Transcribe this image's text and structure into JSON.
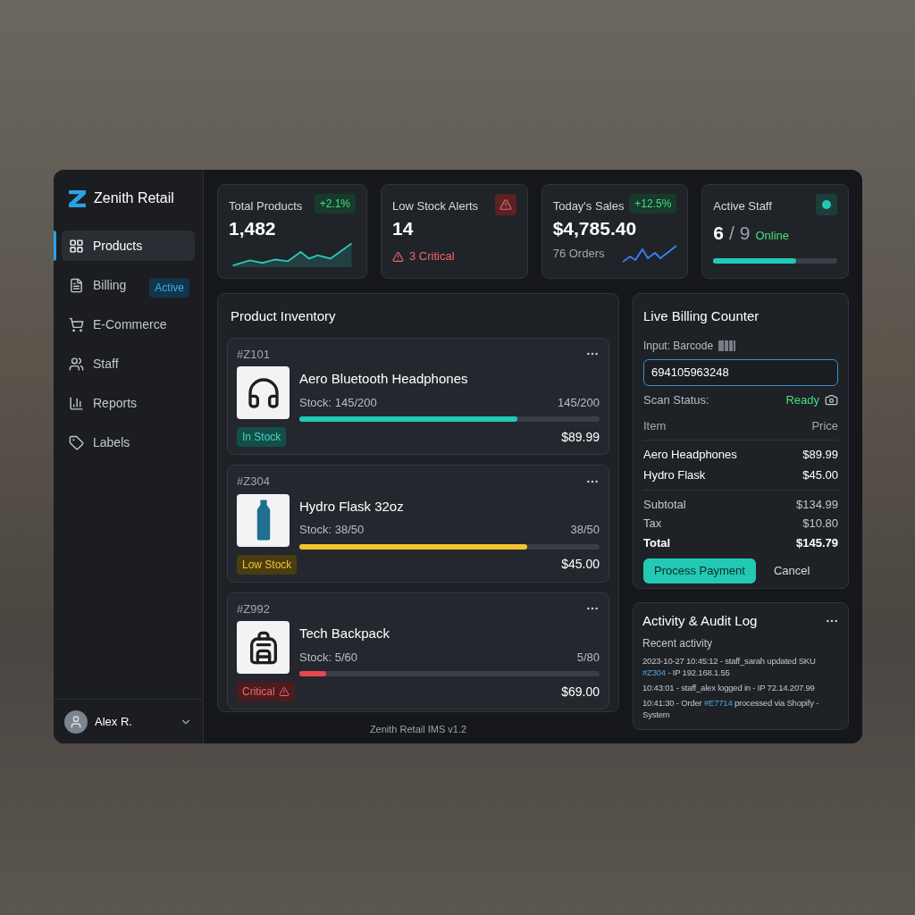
{
  "brand": {
    "name": "Zenith Retail"
  },
  "sidebar": {
    "items": [
      {
        "label": "Products",
        "selected": true
      },
      {
        "label": "Billing",
        "selected": false,
        "badge": "Active"
      },
      {
        "label": "E-Commerce",
        "selected": false
      },
      {
        "label": "Staff",
        "selected": false
      },
      {
        "label": "Reports",
        "selected": false
      },
      {
        "label": "Labels",
        "selected": false
      }
    ],
    "user": {
      "name": "Alex R."
    }
  },
  "stats": [
    {
      "kind": "trend",
      "title": "Total Products",
      "badge": "+2.1%",
      "value": "1,482"
    },
    {
      "kind": "alert",
      "title": "Low Stock Alerts",
      "value": "14",
      "note": "3 Critical"
    },
    {
      "kind": "sales",
      "title": "Today's Sales",
      "badge": "+12.5%",
      "value": "$4,785.40",
      "note": "76 Orders"
    },
    {
      "kind": "staff",
      "title": "Active Staff",
      "value": "6",
      "separator": "/",
      "total": "9",
      "note": "Online",
      "level": 0.667
    }
  ],
  "inventory": {
    "title": "Product Inventory",
    "products": [
      {
        "sku": "#Z101",
        "name": "Aero Bluetooth Headphones",
        "stock": "Stock: 145/200",
        "count": "145/200",
        "level": 0.725,
        "status": "In Stock",
        "kind": "ok",
        "price": "$89.99"
      },
      {
        "sku": "#Z304",
        "name": "Hydro Flask 32oz",
        "stock": "Stock: 38/50",
        "count": "38/50",
        "level": 0.76,
        "status": "Low Stock",
        "kind": "low",
        "price": "$45.00"
      },
      {
        "sku": "#Z992",
        "name": "Tech Backpack",
        "stock": "Stock: 5/60",
        "count": "5/80",
        "level": 0.09,
        "status": "Critical",
        "kind": "critical",
        "price": "$69.00"
      }
    ]
  },
  "footer": "Zenith Retail IMS v1.2",
  "billing": {
    "title": "Live Billing Counter",
    "input_label": "Input: Barcode",
    "value": "694105963248",
    "scan_label": "Scan Status:",
    "scan_status": "Ready",
    "columns": [
      "Item",
      "Price"
    ],
    "items": [
      {
        "name": "Aero Headphones",
        "price": "$89.99"
      },
      {
        "name": "Hydro Flask",
        "price": "$45.00"
      }
    ],
    "totals": [
      {
        "label": "Subtotal",
        "value": "$134.99",
        "bold": false
      },
      {
        "label": "Tax",
        "value": "$10.80",
        "bold": false
      },
      {
        "label": "Total",
        "value": "$145.79",
        "bold": true
      }
    ],
    "primary": "Process Payment",
    "secondary": "Cancel"
  },
  "activity": {
    "title": "Activity & Audit Log",
    "subtitle": "Recent activity",
    "entries": [
      {
        "before": "2023-10-27 10:45:12 - staff_sarah updated SKU ",
        "link": "#Z304",
        "after": " - IP 192.168.1.55"
      },
      {
        "before": "10:43:01 - staff_alex logged in - IP 72.14.207.99"
      },
      {
        "before": "10:41:30 - Order ",
        "link": "#E7714",
        "after": " processed via Shopify - System"
      }
    ]
  }
}
